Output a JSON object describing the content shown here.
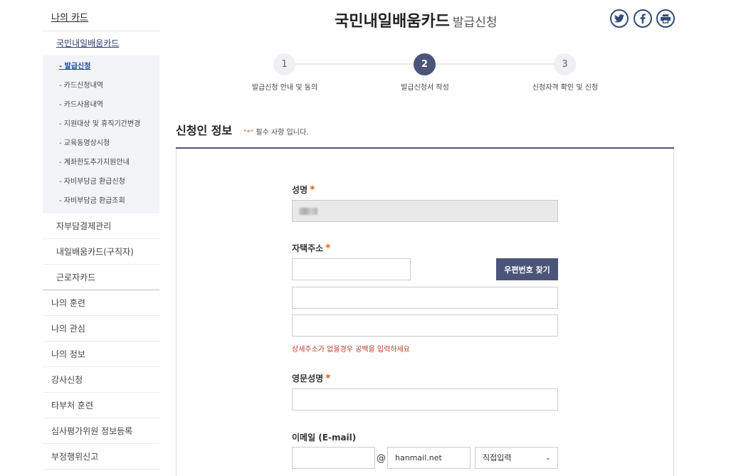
{
  "sidebar": {
    "top": "나의 카드",
    "sub_title": "국민내일배움카드",
    "sub_items": [
      "- 발급신청",
      "- 카드신청내역",
      "- 카드사용내역",
      "- 지원대상 및 휴직기간변경",
      "- 교육동영상시청",
      "- 계좌한도추가지원안내",
      "- 자비부담금 환급신청",
      "- 자비부담금 환급조회"
    ],
    "mid_items": [
      "자부담결제관리",
      "내일배움카드(구직자)",
      "근로자카드"
    ],
    "main_items": [
      "나의 훈련",
      "나의 관심",
      "나의 정보",
      "강사신청",
      "타부처 훈련",
      "심사평가위원 정보등록",
      "부정행위신고"
    ]
  },
  "header": {
    "title": "국민내일배움카드",
    "subtitle": "발급신청",
    "social_icons": [
      "twitter-icon",
      "facebook-icon",
      "print-icon"
    ]
  },
  "steps": [
    {
      "num": "1",
      "label": "발급신청 안내 및 동의"
    },
    {
      "num": "2",
      "label": "발급신청서 작성"
    },
    {
      "num": "3",
      "label": "신청자격 확인 및 신청"
    }
  ],
  "section": {
    "title": "신청인 정보",
    "req_star": "\"*\"",
    "req_text": " 필수 사항 입니다."
  },
  "form": {
    "name_label": "성명",
    "address_label": "자택주소",
    "zip_button": "우편번호 찾기",
    "address_hint": "상세주소가 없을경우 공백을 입력하세요",
    "eng_name_label": "영문성명",
    "email_label": "이메일 (E-mail)",
    "email_at": "@",
    "email_domain": "hanmail.net",
    "email_select": "직접입력",
    "required_mark": "*"
  },
  "colors": {
    "accent": "#4b557a",
    "required": "#d46a1f",
    "hint": "#c0392b"
  }
}
